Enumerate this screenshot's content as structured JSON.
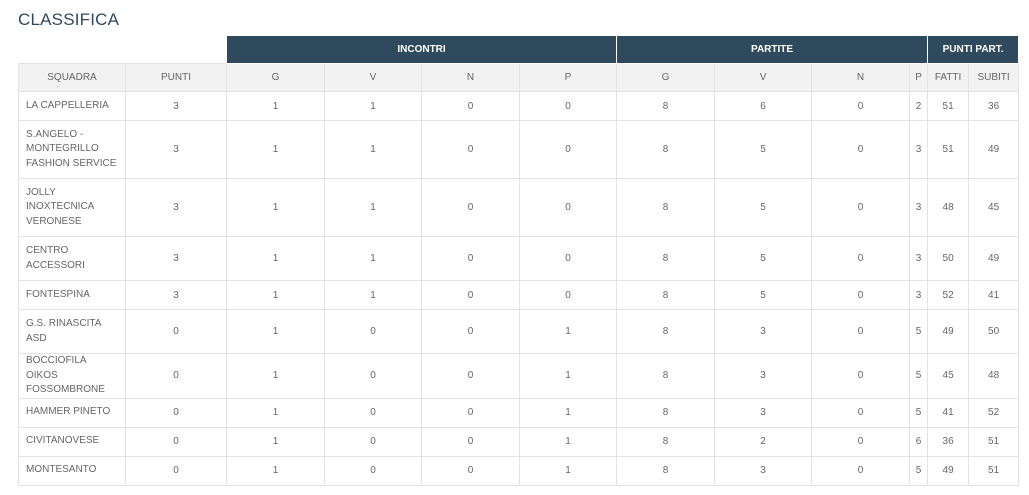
{
  "title": "CLASSIFICA",
  "groups": {
    "incontri": "INCONTRI",
    "partite": "PARTITE",
    "punti_part": "PUNTI PART."
  },
  "columns": [
    "SQUADRA",
    "PUNTI",
    "G",
    "V",
    "N",
    "P",
    "G",
    "V",
    "N",
    "P",
    "FATTI",
    "SUBITI"
  ],
  "rows": [
    {
      "team": "LA CAPPELLERIA",
      "punti": "3",
      "inc_g": "1",
      "inc_v": "1",
      "inc_n": "0",
      "inc_p": "0",
      "par_g": "8",
      "par_v": "6",
      "par_n": "0",
      "par_p": "2",
      "fatti": "51",
      "subiti": "36"
    },
    {
      "team": "S.ANGELO - MONTEGRILLO FASHION SERVICE",
      "punti": "3",
      "inc_g": "1",
      "inc_v": "1",
      "inc_n": "0",
      "inc_p": "0",
      "par_g": "8",
      "par_v": "5",
      "par_n": "0",
      "par_p": "3",
      "fatti": "51",
      "subiti": "49"
    },
    {
      "team": "JOLLY INOXTECNICA VERONESE",
      "punti": "3",
      "inc_g": "1",
      "inc_v": "1",
      "inc_n": "0",
      "inc_p": "0",
      "par_g": "8",
      "par_v": "5",
      "par_n": "0",
      "par_p": "3",
      "fatti": "48",
      "subiti": "45"
    },
    {
      "team": "CENTRO ACCESSORI",
      "punti": "3",
      "inc_g": "1",
      "inc_v": "1",
      "inc_n": "0",
      "inc_p": "0",
      "par_g": "8",
      "par_v": "5",
      "par_n": "0",
      "par_p": "3",
      "fatti": "50",
      "subiti": "49"
    },
    {
      "team": "FONTESPINA",
      "punti": "3",
      "inc_g": "1",
      "inc_v": "1",
      "inc_n": "0",
      "inc_p": "0",
      "par_g": "8",
      "par_v": "5",
      "par_n": "0",
      "par_p": "3",
      "fatti": "52",
      "subiti": "41"
    },
    {
      "team": "G.S. RINASCITA ASD",
      "punti": "0",
      "inc_g": "1",
      "inc_v": "0",
      "inc_n": "0",
      "inc_p": "1",
      "par_g": "8",
      "par_v": "3",
      "par_n": "0",
      "par_p": "5",
      "fatti": "49",
      "subiti": "50"
    },
    {
      "team": "BOCCIOFILA OIKOS FOSSOMBRONE",
      "punti": "0",
      "inc_g": "1",
      "inc_v": "0",
      "inc_n": "0",
      "inc_p": "1",
      "par_g": "8",
      "par_v": "3",
      "par_n": "0",
      "par_p": "5",
      "fatti": "45",
      "subiti": "48"
    },
    {
      "team": "HAMMER PINETO",
      "punti": "0",
      "inc_g": "1",
      "inc_v": "0",
      "inc_n": "0",
      "inc_p": "1",
      "par_g": "8",
      "par_v": "3",
      "par_n": "0",
      "par_p": "5",
      "fatti": "41",
      "subiti": "52"
    },
    {
      "team": "CIVITANOVESE",
      "punti": "0",
      "inc_g": "1",
      "inc_v": "0",
      "inc_n": "0",
      "inc_p": "1",
      "par_g": "8",
      "par_v": "2",
      "par_n": "0",
      "par_p": "6",
      "fatti": "36",
      "subiti": "51"
    },
    {
      "team": "MONTESANTO",
      "punti": "0",
      "inc_g": "1",
      "inc_v": "0",
      "inc_n": "0",
      "inc_p": "1",
      "par_g": "8",
      "par_v": "3",
      "par_n": "0",
      "par_p": "5",
      "fatti": "49",
      "subiti": "51"
    }
  ]
}
